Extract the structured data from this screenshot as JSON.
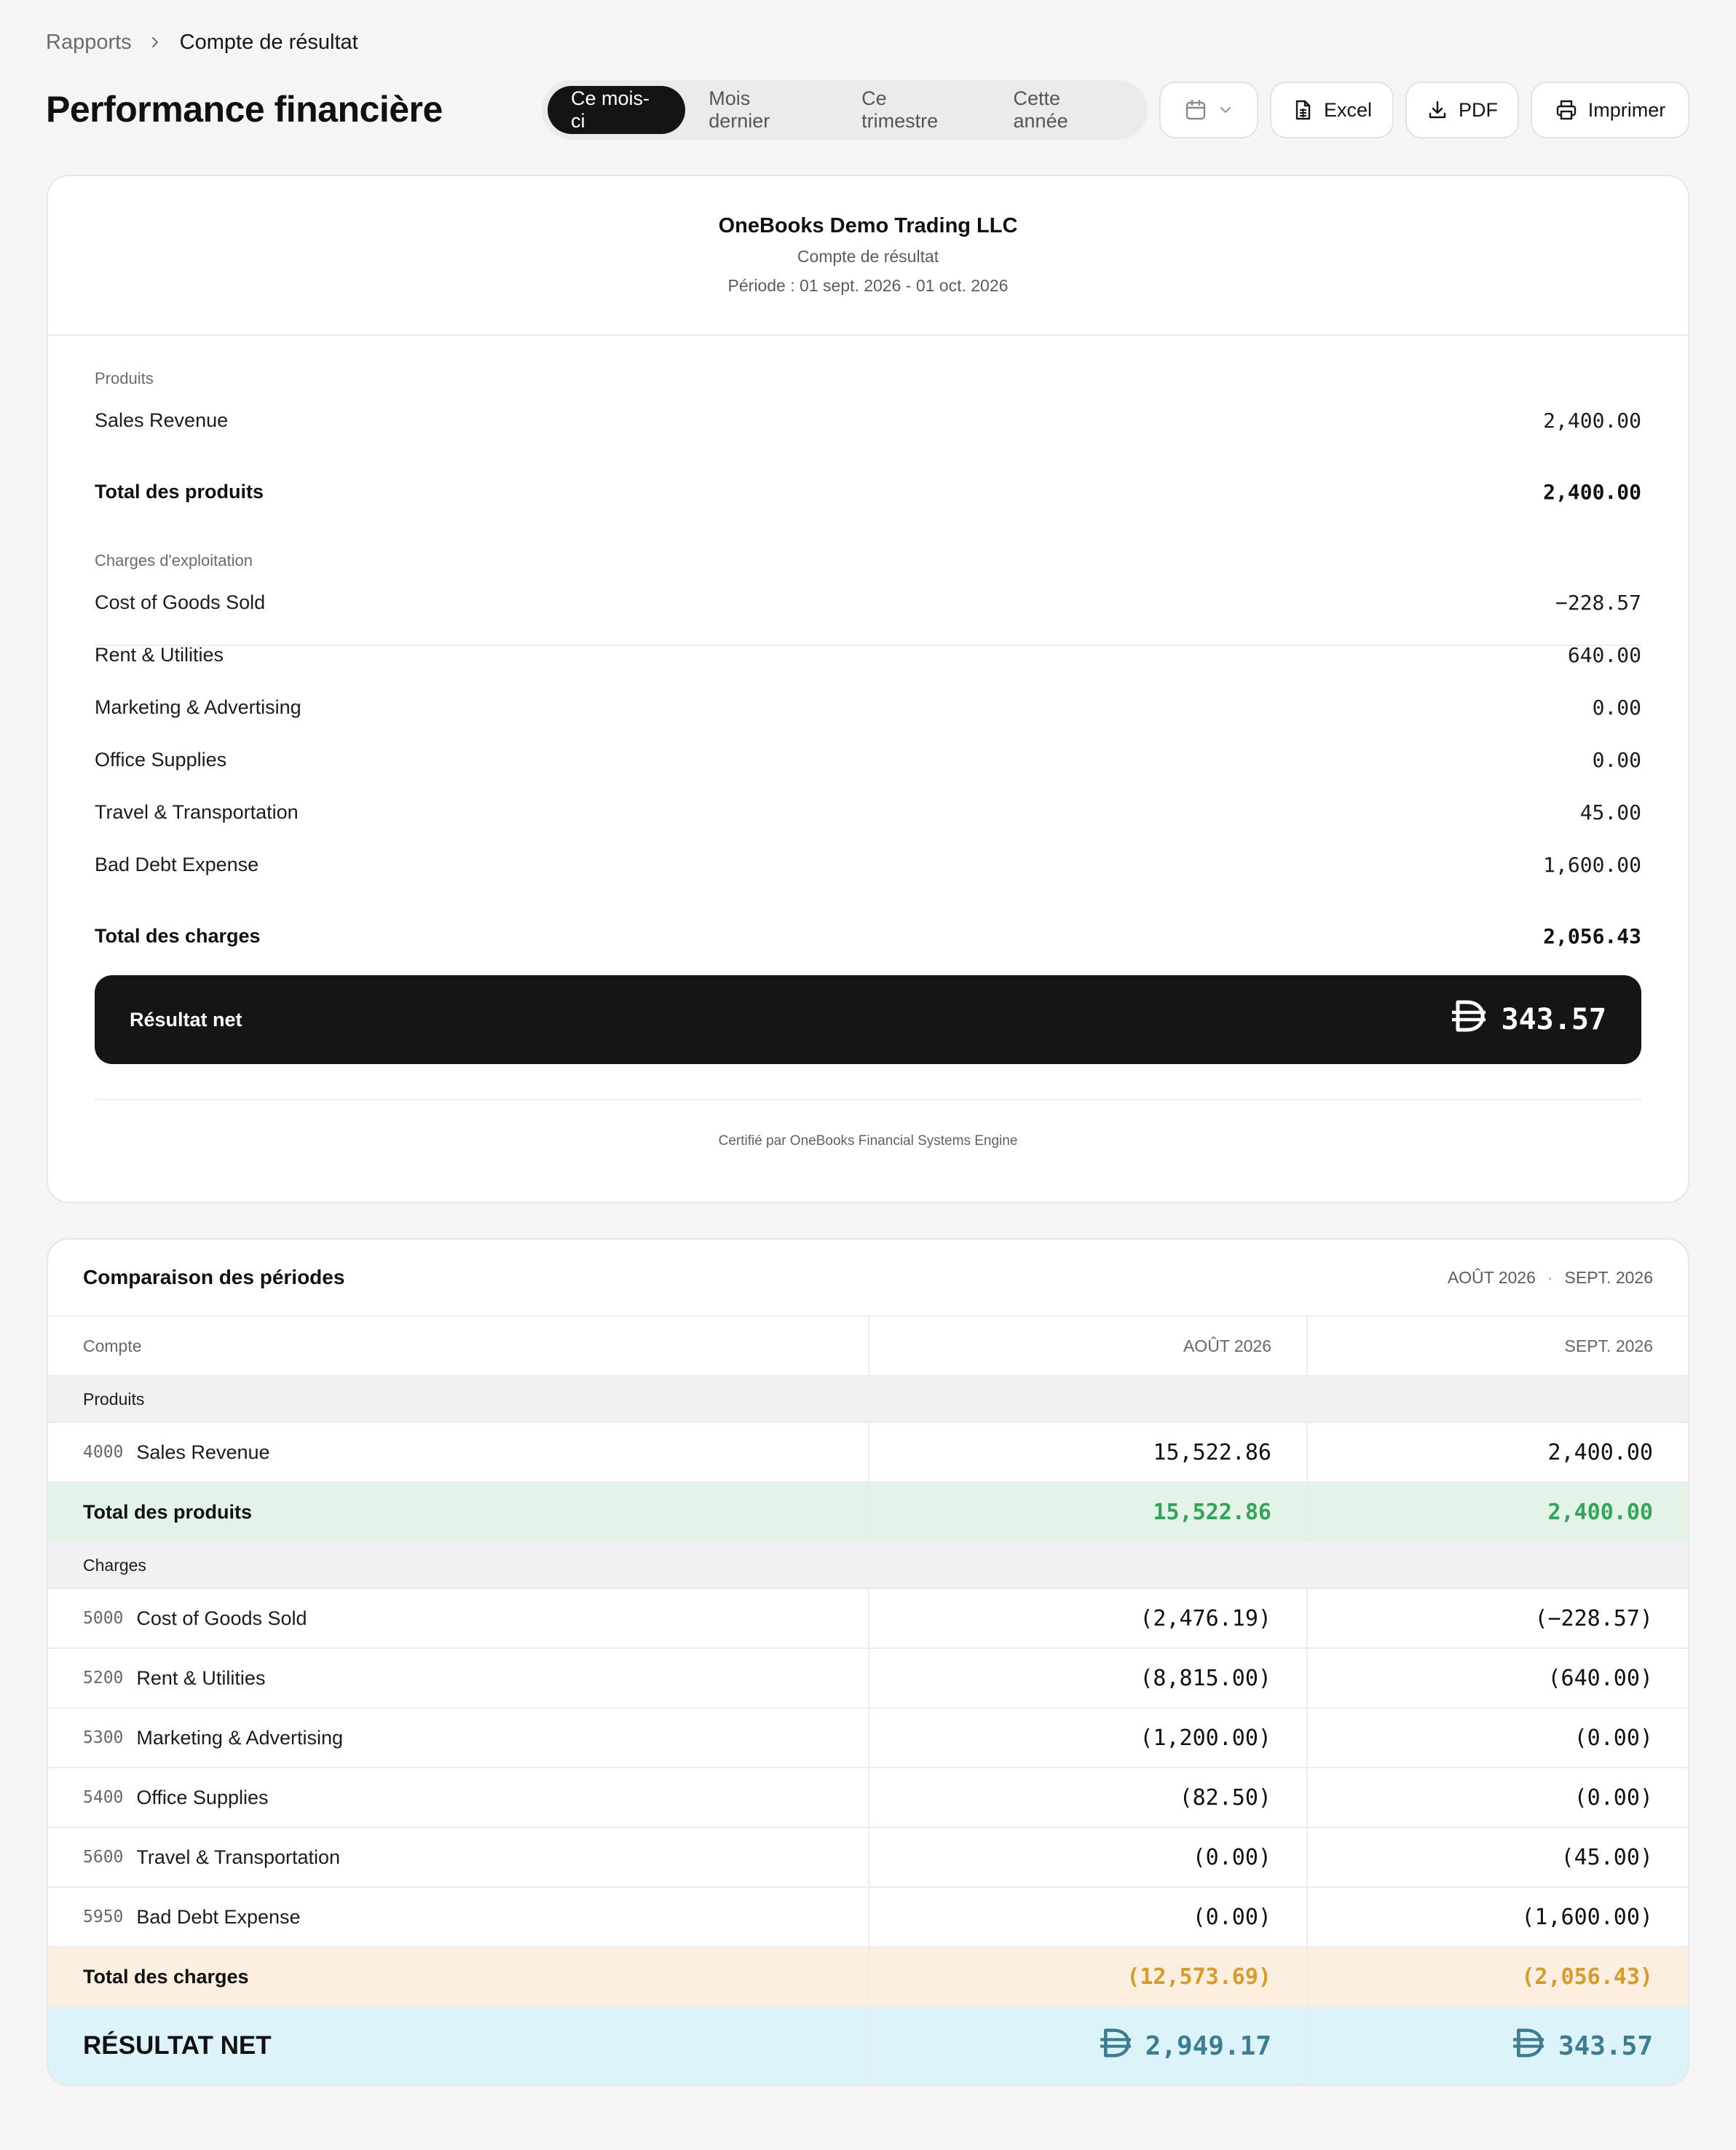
{
  "breadcrumb": {
    "parent": "Rapports",
    "current": "Compte de résultat"
  },
  "header": {
    "title": "Performance financière",
    "periods": [
      "Ce mois-ci",
      "Mois dernier",
      "Ce trimestre",
      "Cette année"
    ],
    "active_period": "Ce mois-ci",
    "excel_label": "Excel",
    "pdf_label": "PDF",
    "print_label": "Imprimer"
  },
  "report": {
    "company": "OneBooks Demo Trading LLC",
    "type": "Compte de résultat",
    "period": "Période : 01 sept. 2026 - 01 oct. 2026",
    "income_label": "Produits",
    "income": [
      {
        "name": "Sales Revenue",
        "amount": "2,400.00"
      }
    ],
    "total_income_label": "Total des produits",
    "total_income": "2,400.00",
    "expenses_label": "Charges d'exploitation",
    "expenses": [
      {
        "name": "Cost of Goods Sold",
        "amount": "−228.57"
      },
      {
        "name": "Rent & Utilities",
        "amount": "640.00"
      },
      {
        "name": "Marketing & Advertising",
        "amount": "0.00"
      },
      {
        "name": "Office Supplies",
        "amount": "0.00"
      },
      {
        "name": "Travel & Transportation",
        "amount": "45.00"
      },
      {
        "name": "Bad Debt Expense",
        "amount": "1,600.00"
      }
    ],
    "total_expenses_label": "Total des charges",
    "total_expenses": "2,056.43",
    "net_label": "Résultat net",
    "net_amount": "343.57",
    "certification": "Certifié par OneBooks Financial Systems Engine"
  },
  "comparison": {
    "title": "Comparaison des périodes",
    "period_a": "AOÛT 2026",
    "period_b": "SEPT. 2026",
    "col_account": "Compte",
    "col_a": "AOÛT 2026",
    "col_b": "SEPT. 2026",
    "income_group": "Produits",
    "income_rows": [
      {
        "code": "4000",
        "name": "Sales Revenue",
        "a": "15,522.86",
        "b": "2,400.00"
      }
    ],
    "total_income_label": "Total des produits",
    "total_income_a": "15,522.86",
    "total_income_b": "2,400.00",
    "expense_group": "Charges",
    "expense_rows": [
      {
        "code": "5000",
        "name": "Cost of Goods Sold",
        "a": "(2,476.19)",
        "b": "(−228.57)"
      },
      {
        "code": "5200",
        "name": "Rent & Utilities",
        "a": "(8,815.00)",
        "b": "(640.00)"
      },
      {
        "code": "5300",
        "name": "Marketing & Advertising",
        "a": "(1,200.00)",
        "b": "(0.00)"
      },
      {
        "code": "5400",
        "name": "Office Supplies",
        "a": "(82.50)",
        "b": "(0.00)"
      },
      {
        "code": "5600",
        "name": "Travel & Transportation",
        "a": "(0.00)",
        "b": "(45.00)"
      },
      {
        "code": "5950",
        "name": "Bad Debt Expense",
        "a": "(0.00)",
        "b": "(1,600.00)"
      }
    ],
    "total_expenses_label": "Total des charges",
    "total_expenses_a": "(12,573.69)",
    "total_expenses_b": "(2,056.43)",
    "net_label": "RÉSULTAT NET",
    "net_a": "2,949.17",
    "net_b": "343.57"
  },
  "colors": {
    "accent_dark": "#131416",
    "income_total": "#35a45a",
    "expense_total": "#d89a2b",
    "net_result": "#3e7c92"
  },
  "icons": {
    "breadcrumb_separator": "chevron-right-icon",
    "date_picker": "calendar-icon",
    "date_dropdown": "chevron-down-icon",
    "excel": "file-spreadsheet-icon",
    "pdf": "download-icon",
    "print": "printer-icon",
    "currency": "dirham-currency-icon"
  }
}
